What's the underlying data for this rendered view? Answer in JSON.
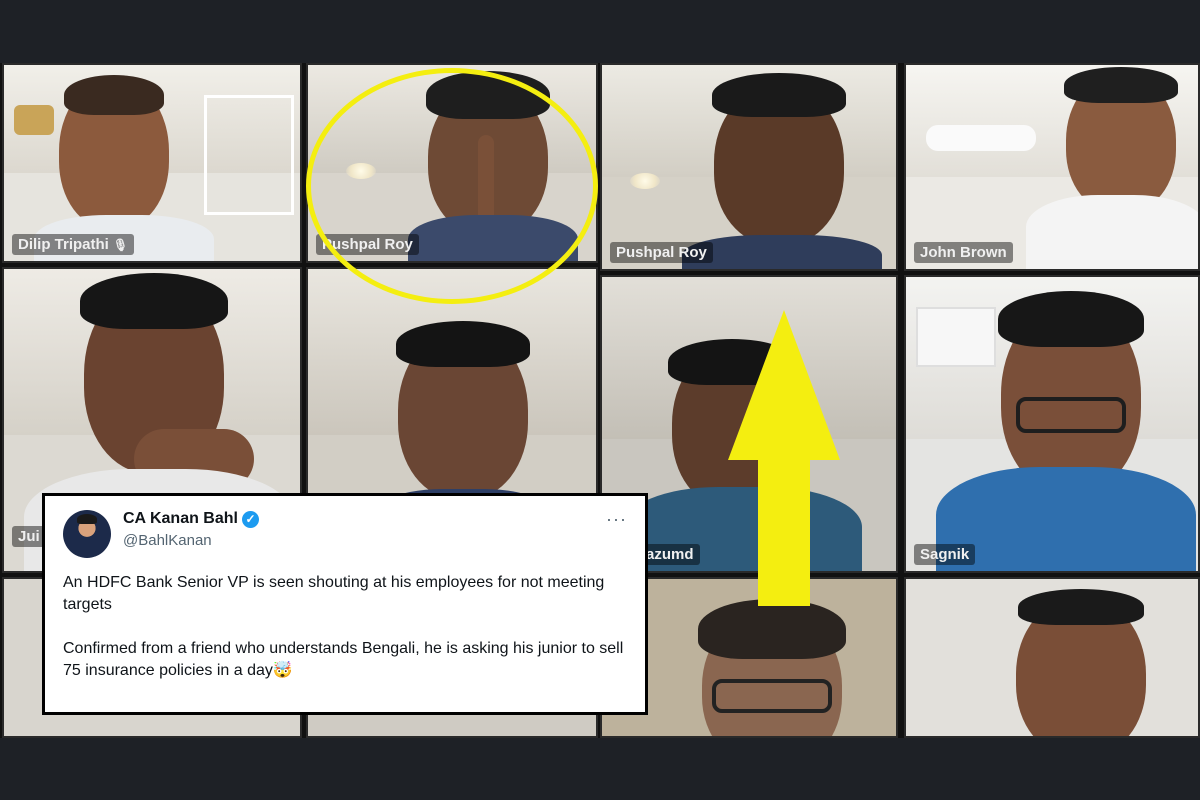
{
  "tiles": [
    {
      "name": "Dilip Tripathi",
      "mic": "🎙"
    },
    {
      "name": "Pushpal Roy"
    },
    {
      "name": "Pushpal Roy"
    },
    {
      "name": "John Brown"
    },
    {
      "name": "Jui"
    },
    {
      "name": ""
    },
    {
      "name": "ta Mazumd"
    },
    {
      "name": "Sagnik"
    },
    {
      "name": ""
    },
    {
      "name": ""
    },
    {
      "name": ""
    },
    {
      "name": ""
    }
  ],
  "tweet": {
    "display_name": "CA Kanan Bahl",
    "handle": "@BahlKanan",
    "verified_icon": "✓",
    "more_icon": "···",
    "paragraph_1": "An HDFC Bank Senior VP is seen shouting at his employees for not meeting targets",
    "paragraph_2": "Confirmed from a friend who understands Bengali, he is asking his junior to sell 75 insurance policies in a day🤯"
  },
  "colors": {
    "highlight": "#f4ee10",
    "verified": "#1d9bf0"
  }
}
